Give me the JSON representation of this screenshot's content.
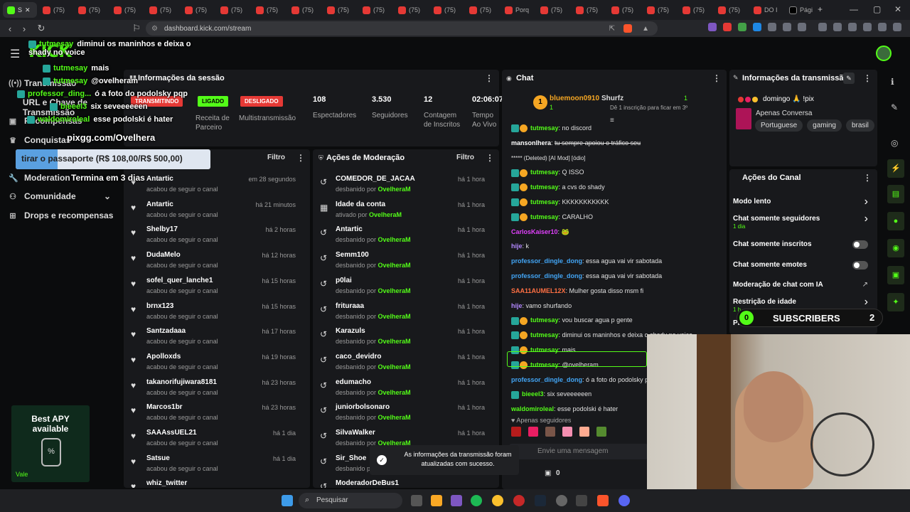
{
  "browser": {
    "tabs": [
      {
        "label": "S",
        "icon": "kick-favicon",
        "active": true
      },
      {
        "label": "(75)"
      },
      {
        "label": "(75)"
      },
      {
        "label": "(75)"
      },
      {
        "label": "(75)"
      },
      {
        "label": "(75)"
      },
      {
        "label": "(75)"
      },
      {
        "label": "(75)"
      },
      {
        "label": "(75)"
      },
      {
        "label": "(75)"
      },
      {
        "label": "(75)"
      },
      {
        "label": "(75)"
      },
      {
        "label": "(75)"
      },
      {
        "label": "(75)"
      },
      {
        "label": "Porq"
      },
      {
        "label": "(75)"
      },
      {
        "label": "(75)"
      },
      {
        "label": "(75)"
      },
      {
        "label": "(75)"
      },
      {
        "label": "(75)"
      },
      {
        "label": "(75)"
      },
      {
        "label": "DO I"
      },
      {
        "label": "Pági"
      }
    ],
    "url": "dashboard.kick.com/stream"
  },
  "logo": "KICK",
  "overlay_chat": [
    {
      "user": "tutmesay",
      "text": "diminui os maninhos e deixa o shady no voice"
    },
    {
      "user": "tutmesay",
      "text": "mais"
    },
    {
      "user": "tutmesay",
      "text": "@ovelheram"
    },
    {
      "user": "professor_ding...",
      "text": "ó a foto do podolsky pqp"
    },
    {
      "user": "bieeel3",
      "text": "six seveeeeeen"
    },
    {
      "user": "waldomiroleal",
      "text": "esse podolski é hater"
    }
  ],
  "overlay": {
    "pix_link": "pixgg.com/Ovelhera",
    "goal_text": "tirar o passaporte (R$ 108,00/R$ 500,00)",
    "goal_progress": 0.216,
    "ends_text": "Termina em 3 dias",
    "subs_count": "0",
    "subs_label": "SUBSCRIBERS",
    "subs_goal": "2",
    "viewer_count": "108",
    "apy_title": "Best APY",
    "apy_sub": "available",
    "apy_brand": "Vale"
  },
  "sidebar": {
    "items": [
      {
        "label": "Transmissão",
        "icon": "broadcast-icon"
      },
      {
        "label": "URL e Chave de Transmissão",
        "icon": "key-icon"
      },
      {
        "label": "Recompensas",
        "icon": "gift-icon"
      },
      {
        "label": "Conquistas",
        "icon": "trophy-icon"
      },
      {
        "label": "Moderation",
        "icon": "wrench-icon"
      },
      {
        "label": "Comunidade",
        "icon": "community-icon"
      },
      {
        "label": "Drops e recompensas",
        "icon": "drops-icon"
      }
    ]
  },
  "session": {
    "title": "Informações da sessão",
    "live_badge": "TRANSMITINDO",
    "on_badge": "LIGADO",
    "off_badge": "DESLIGADO",
    "receita_label": "Receita de Parceiro",
    "multi_label": "Multistransmissão",
    "stats": [
      {
        "value": "108",
        "label": "Espectadores"
      },
      {
        "value": "3.530",
        "label": "Seguidores"
      },
      {
        "value": "12",
        "label": "Contagem de Inscritos"
      },
      {
        "value": "02:06:07",
        "label": "Tempo Ao Vivo"
      }
    ]
  },
  "activity": {
    "filter_label": "Filtro",
    "rows": [
      {
        "name": "Antartic",
        "sub": "acabou de seguir o canal",
        "time": "em 28 segundos"
      },
      {
        "name": "Antartic",
        "sub": "acabou de seguir o canal",
        "time": "há 21 minutos"
      },
      {
        "name": "Shelby17",
        "sub": "acabou de seguir o canal",
        "time": "há 2 horas"
      },
      {
        "name": "DudaMelo",
        "sub": "acabou de seguir o canal",
        "time": "há 12 horas"
      },
      {
        "name": "sofel_quer_lanche1",
        "sub": "acabou de seguir o canal",
        "time": "há 15 horas"
      },
      {
        "name": "brnx123",
        "sub": "acabou de seguir o canal",
        "time": "há 15 horas"
      },
      {
        "name": "Santzadaaa",
        "sub": "acabou de seguir o canal",
        "time": "há 17 horas"
      },
      {
        "name": "Apolloxds",
        "sub": "acabou de seguir o canal",
        "time": "há 19 horas"
      },
      {
        "name": "takanorifujiwara8181",
        "sub": "acabou de seguir o canal",
        "time": "há 23 horas"
      },
      {
        "name": "Marcos1br",
        "sub": "acabou de seguir o canal",
        "time": "há 23 horas"
      },
      {
        "name": "SAAAssUEL21",
        "sub": "acabou de seguir o canal",
        "time": "há 1 dia"
      },
      {
        "name": "Satsue",
        "sub": "acabou de seguir o canal",
        "time": "há 1 dia"
      },
      {
        "name": "whiz_twitter",
        "sub": "",
        "time": ""
      }
    ]
  },
  "modactions": {
    "title": "Ações de Moderação",
    "filter_label": "Filtro",
    "rows": [
      {
        "name": "COMEDOR_DE_JACAA",
        "pre": "desbanido por ",
        "by": "OvelheraM",
        "time": "há 1 hora",
        "icon": "undo-icon"
      },
      {
        "name": "Idade da conta",
        "pre": "ativado por ",
        "by": "OvelheraM",
        "time": "há 1 hora",
        "icon": "calendar-icon"
      },
      {
        "name": "Antartic",
        "pre": "desbanido por ",
        "by": "OvelheraM",
        "time": "há 1 hora",
        "icon": "undo-icon"
      },
      {
        "name": "Semm100",
        "pre": "desbanido por ",
        "by": "OvelheraM",
        "time": "há 1 hora",
        "icon": "undo-icon"
      },
      {
        "name": "p0lai",
        "pre": "desbanido por ",
        "by": "OvelheraM",
        "time": "há 1 hora",
        "icon": "undo-icon"
      },
      {
        "name": "frituraaa",
        "pre": "desbanido por ",
        "by": "OvelheraM",
        "time": "há 1 hora",
        "icon": "undo-icon"
      },
      {
        "name": "Karazuls",
        "pre": "desbanido por ",
        "by": "OvelheraM",
        "time": "há 1 hora",
        "icon": "undo-icon"
      },
      {
        "name": "caco_devidro",
        "pre": "desbanido por ",
        "by": "OvelheraM",
        "time": "há 1 hora",
        "icon": "undo-icon"
      },
      {
        "name": "edumacho",
        "pre": "desbanido por ",
        "by": "OvelheraM",
        "time": "há 1 hora",
        "icon": "undo-icon"
      },
      {
        "name": "juniorbolsonaro",
        "pre": "desbanido por ",
        "by": "OvelheraM",
        "time": "há 1 hora",
        "icon": "undo-icon"
      },
      {
        "name": "SilvaWalker",
        "pre": "desbanido por ",
        "by": "OvelheraM",
        "time": "há 1 hora",
        "icon": "undo-icon"
      },
      {
        "name": "Sir_Shoe",
        "pre": "desbanido por ",
        "by": "OvelheraM",
        "time": "há 1 hora",
        "icon": "undo-icon"
      },
      {
        "name": "ModeradorDeBus1",
        "pre": "",
        "by": "",
        "time": "",
        "icon": "undo-icon"
      }
    ]
  },
  "chat": {
    "title": "Chat",
    "gifter_user": "bluemoon0910",
    "gifter_count": "1",
    "gifter2_user": "Shurfz",
    "gifter2_count": "1",
    "gift_cta": "Dê 1 inscrição para ficar em 3º",
    "messages": [
      {
        "user": "tutmesay",
        "color": "#53fc18",
        "text": "no discord",
        "badges": 2
      },
      {
        "user": "mansonlhera",
        "color": "#ffffff",
        "text": "tu sempre apoiou o tráfico seu",
        "strike": true,
        "badges": 0
      },
      {
        "user": "",
        "color": "#ffffff",
        "text": "***** (Deleted) [AI Mod] [ódio]",
        "badges": 0
      },
      {
        "user": "tutmesay",
        "color": "#53fc18",
        "text": "Q ISSO",
        "badges": 2
      },
      {
        "user": "tutmesay",
        "color": "#53fc18",
        "text": "a cvs do shady",
        "badges": 2
      },
      {
        "user": "tutmesay",
        "color": "#53fc18",
        "text": "KKKKKKKKKKK",
        "badges": 2
      },
      {
        "user": "tutmesay",
        "color": "#53fc18",
        "text": "CARALHO",
        "badges": 2
      },
      {
        "user": "CarlosKaiser10",
        "color": "#e040fb",
        "text": "🐸",
        "badges": 0
      },
      {
        "user": "hije",
        "color": "#b388ff",
        "text": "k",
        "badges": 0
      },
      {
        "user": "professor_dingle_dong",
        "color": "#42a5f5",
        "text": "essa agua vai vir sabotada",
        "badges": 0
      },
      {
        "user": "professor_dingle_dong",
        "color": "#42a5f5",
        "text": "essa agua vai vir sabotada",
        "badges": 0
      },
      {
        "user": "SAA11AUMEL12X",
        "color": "#ff7043",
        "text": "Mulher gosta disso msm fi",
        "badges": 0
      },
      {
        "user": "hije",
        "color": "#b388ff",
        "text": "vamo shurfando",
        "badges": 0
      },
      {
        "user": "tutmesay",
        "color": "#53fc18",
        "text": "vou buscar agua p gente",
        "badges": 2
      },
      {
        "user": "tutmesay",
        "color": "#53fc18",
        "text": "diminui os maninhos e deixa o shady no voice",
        "badges": 2
      },
      {
        "user": "tutmesay",
        "color": "#53fc18",
        "text": "mais",
        "badges": 2
      },
      {
        "user": "tutmesay",
        "color": "#53fc18",
        "text": "@ovelheram",
        "badges": 2,
        "highlight": true
      },
      {
        "user": "professor_dingle_dong",
        "color": "#42a5f5",
        "text": "ó a foto do podolsky p",
        "badges": 0
      },
      {
        "user": "bieeel3",
        "color": "#53fc18",
        "text": "six seveeeeeen",
        "badges": 1
      },
      {
        "user": "waldomiroleal",
        "color": "#53fc18",
        "text": "esse podolski é hater",
        "badges": 0
      }
    ],
    "followers_only": "Apenas seguidores",
    "input_placeholder": "Envie uma mensagem",
    "points": "0",
    "toast": "As informações da transmissão foram atualizadas com sucesso."
  },
  "streaminfo": {
    "title": "Informações da transmissão",
    "stream_title": "domingo 🙏 !pix",
    "category": "Apenas Conversa",
    "tags": [
      "Portuguese",
      "gaming",
      "brasil"
    ]
  },
  "channel": {
    "title": "Ações do Canal",
    "items": [
      {
        "label": "Modo lento",
        "sub": "",
        "control": "arrow"
      },
      {
        "label": "Chat somente seguidores",
        "sub": "1 dia",
        "control": "arrow"
      },
      {
        "label": "Chat somente inscritos",
        "sub": "",
        "control": "toggle"
      },
      {
        "label": "Chat somente emotes",
        "sub": "",
        "control": "toggle"
      },
      {
        "label": "Moderação de chat com IA",
        "sub": "",
        "control": "external"
      },
      {
        "label": "Restrição de idade",
        "sub": "1 h",
        "control": "arrow"
      },
      {
        "label": "Palavras banidas",
        "sub": "",
        "control": "arrow"
      }
    ]
  },
  "taskbar": {
    "search_placeholder": "Pesquisar"
  },
  "colors": {
    "accent": "#53fc18",
    "danger": "#e53935",
    "bg": "#0b0c0d",
    "panel": "#18191c"
  }
}
